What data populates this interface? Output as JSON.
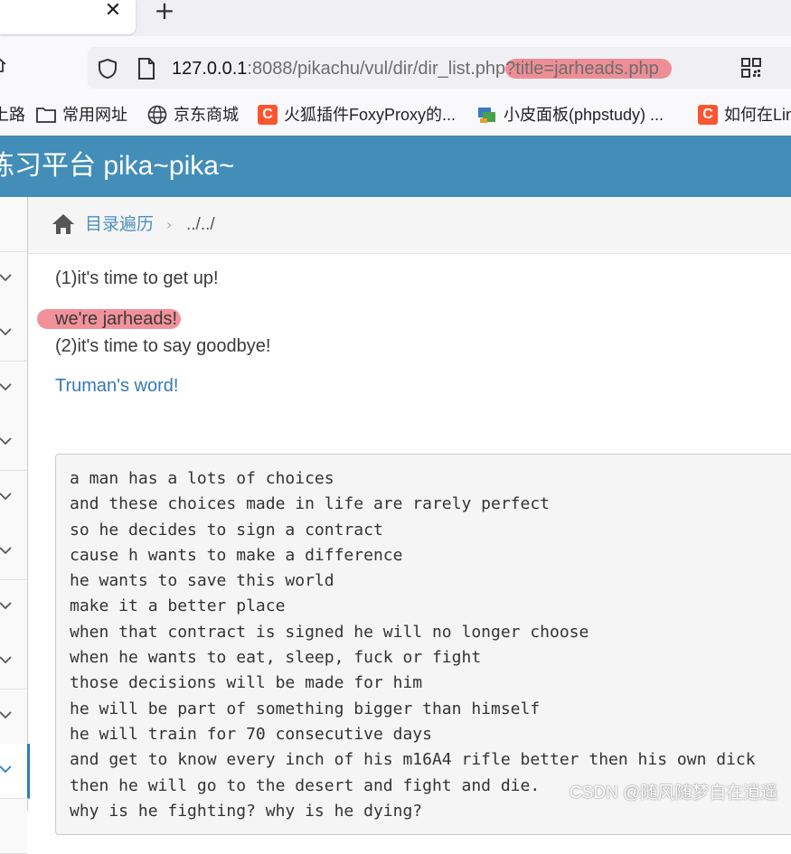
{
  "browser": {
    "address_bar": {
      "host": "127.0.0.1",
      "path": ":8088/pikachu/vul/dir/dir_list.php",
      "query": "?title=jarheads.php"
    },
    "bookmarks": [
      {
        "label": "上路",
        "icon": "cut-off-icon"
      },
      {
        "label": "常用网址",
        "icon": "folder-icon"
      },
      {
        "label": "京东商城",
        "icon": "globe-icon"
      },
      {
        "label": "火狐插件FoxyProxy的...",
        "icon": "csdn-icon"
      },
      {
        "label": "小皮面板(phpstudy) ...",
        "icon": "phpstudy-icon"
      },
      {
        "label": "如何在Lin",
        "icon": "csdn-icon"
      }
    ],
    "csdn_icon_letter": "C"
  },
  "app": {
    "title": "练习平台 pika~pika~",
    "header_color": "#438eb9"
  },
  "breadcrumb": {
    "link": "目录遍历",
    "separator": "›",
    "current": "../../"
  },
  "content": {
    "line1": "(1)it's time to get up!",
    "highlight": "we're jarheads!",
    "line2": "(2)it's time to say goodbye!",
    "link": "Truman's word!",
    "poem": [
      "a man has a lots of choices",
      "and these choices made in life are rarely perfect",
      "so he decides to sign a contract",
      "cause h wants to make a difference",
      "he wants to save this world",
      "make it a better place",
      "when that contract is signed he will no longer choose",
      "when he wants to eat, sleep, fuck or fight",
      "those decisions will be made for him",
      "he will be part of something bigger than himself",
      "he will train for 70 consecutive days",
      "and get to know every inch of his m16A4 rifle better then his own dick",
      "then he will go to the desert and fight and die.",
      "why is he fighting? why is he dying?"
    ]
  },
  "watermark": "CSDN @随风随梦自在逍遥"
}
